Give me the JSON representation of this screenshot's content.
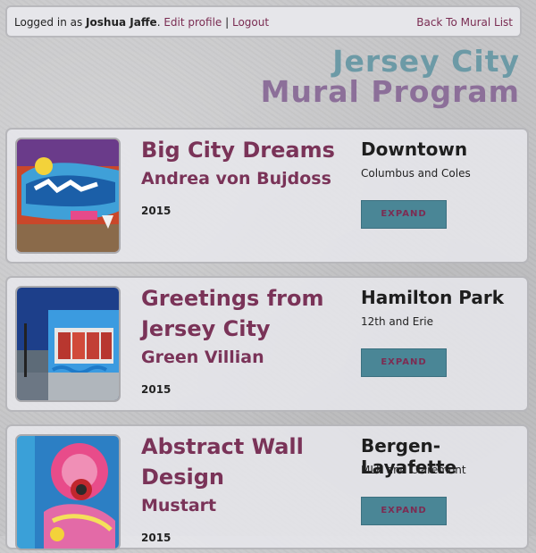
{
  "header": {
    "logged_in_prefix": "Logged in as ",
    "username": "Joshua Jaffe",
    "period": ".",
    "edit_profile": "Edit profile",
    "separator": " | ",
    "logout": "Logout",
    "back_link": "Back To Mural List"
  },
  "logo": {
    "line1": "Jersey City",
    "line2": "Mural Program"
  },
  "murals": [
    {
      "title": "Big City Dreams",
      "artist": "Andrea von Bujdoss",
      "year": "2015",
      "neighborhood": "Downtown",
      "location": "Columbus and Coles",
      "button": "EXPAND"
    },
    {
      "title": "Greetings from Jersey City",
      "artist": "Green Villian",
      "year": "2015",
      "neighborhood": "Hamilton Park",
      "location": "12th and Erie",
      "button": "EXPAND"
    },
    {
      "title": "Abstract Wall Design",
      "artist": "Mustart",
      "year": "2015",
      "neighborhood": "Bergen-Layafette",
      "location": "MLK and Claremont",
      "button": "EXPAND"
    }
  ]
}
